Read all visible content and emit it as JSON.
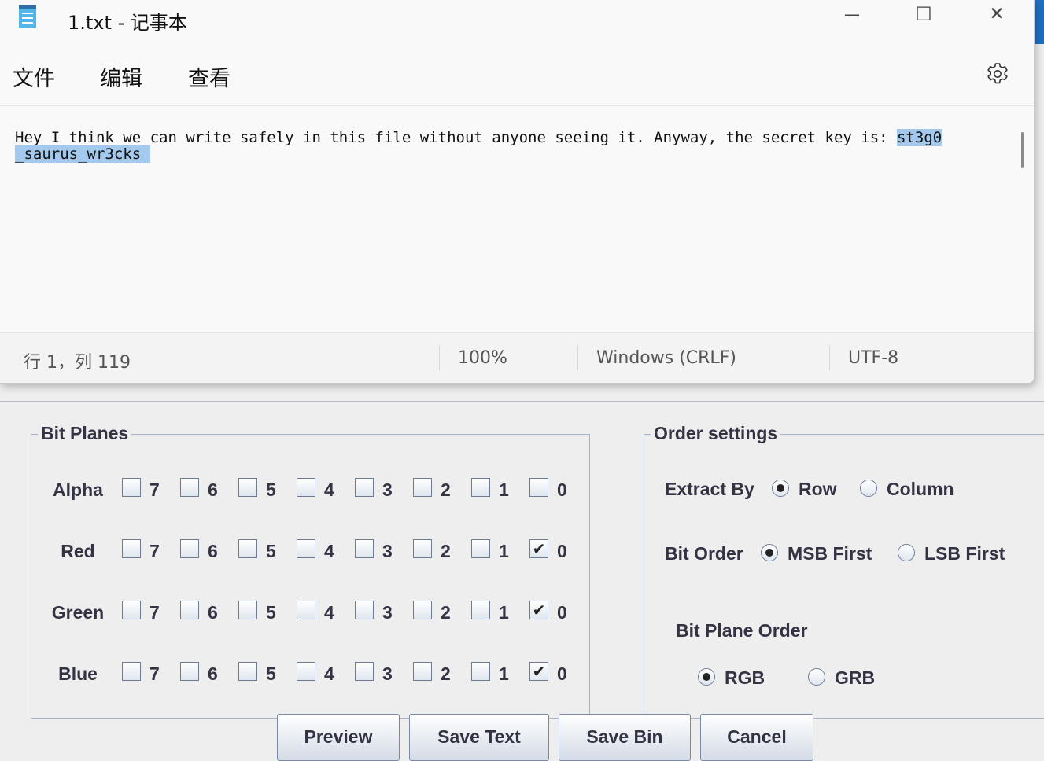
{
  "notepad": {
    "title": "1.txt - 记事本",
    "window_controls": {
      "minimize": "—",
      "maximize": "☐",
      "close": "✕"
    },
    "menu": [
      "文件",
      "编辑",
      "查看"
    ],
    "content_plain": "Hey I think we can write safely in this file without anyone seeing it. Anyway, the secret key is: ",
    "content_selected_1": "st3g0",
    "content_selected_2": "_saurus_wr3cks ",
    "status": {
      "position": "行 1，列 119",
      "zoom": "100%",
      "line_ending": "Windows (CRLF)",
      "encoding": "UTF-8"
    }
  },
  "stegsolve": {
    "bit_planes": {
      "title": "Bit Planes",
      "bits": [
        "7",
        "6",
        "5",
        "4",
        "3",
        "2",
        "1",
        "0"
      ],
      "rows": [
        {
          "label": "Alpha",
          "checked": []
        },
        {
          "label": "Red",
          "checked": [
            "0"
          ]
        },
        {
          "label": "Green",
          "checked": [
            "0"
          ]
        },
        {
          "label": "Blue",
          "checked": [
            "0"
          ]
        }
      ]
    },
    "order_settings": {
      "title": "Order settings",
      "extract_by": {
        "label": "Extract By",
        "options": [
          "Row",
          "Column"
        ],
        "selected": "Row"
      },
      "bit_order": {
        "label": "Bit Order",
        "options": [
          "MSB First",
          "LSB First"
        ],
        "selected": "MSB First"
      },
      "bit_plane_order": {
        "label": "Bit Plane Order",
        "options": [
          "RGB",
          "GRB"
        ],
        "selected": "RGB"
      }
    },
    "buttons": {
      "preview": "Preview",
      "save_text": "Save Text",
      "save_bin": "Save Bin",
      "cancel": "Cancel"
    }
  },
  "colors": {
    "selection": "#a3c9ee",
    "notepad_bg": "#f9f9f9",
    "dialog_bg": "#eeeeee",
    "accent_edge": "#1f6fbf"
  }
}
